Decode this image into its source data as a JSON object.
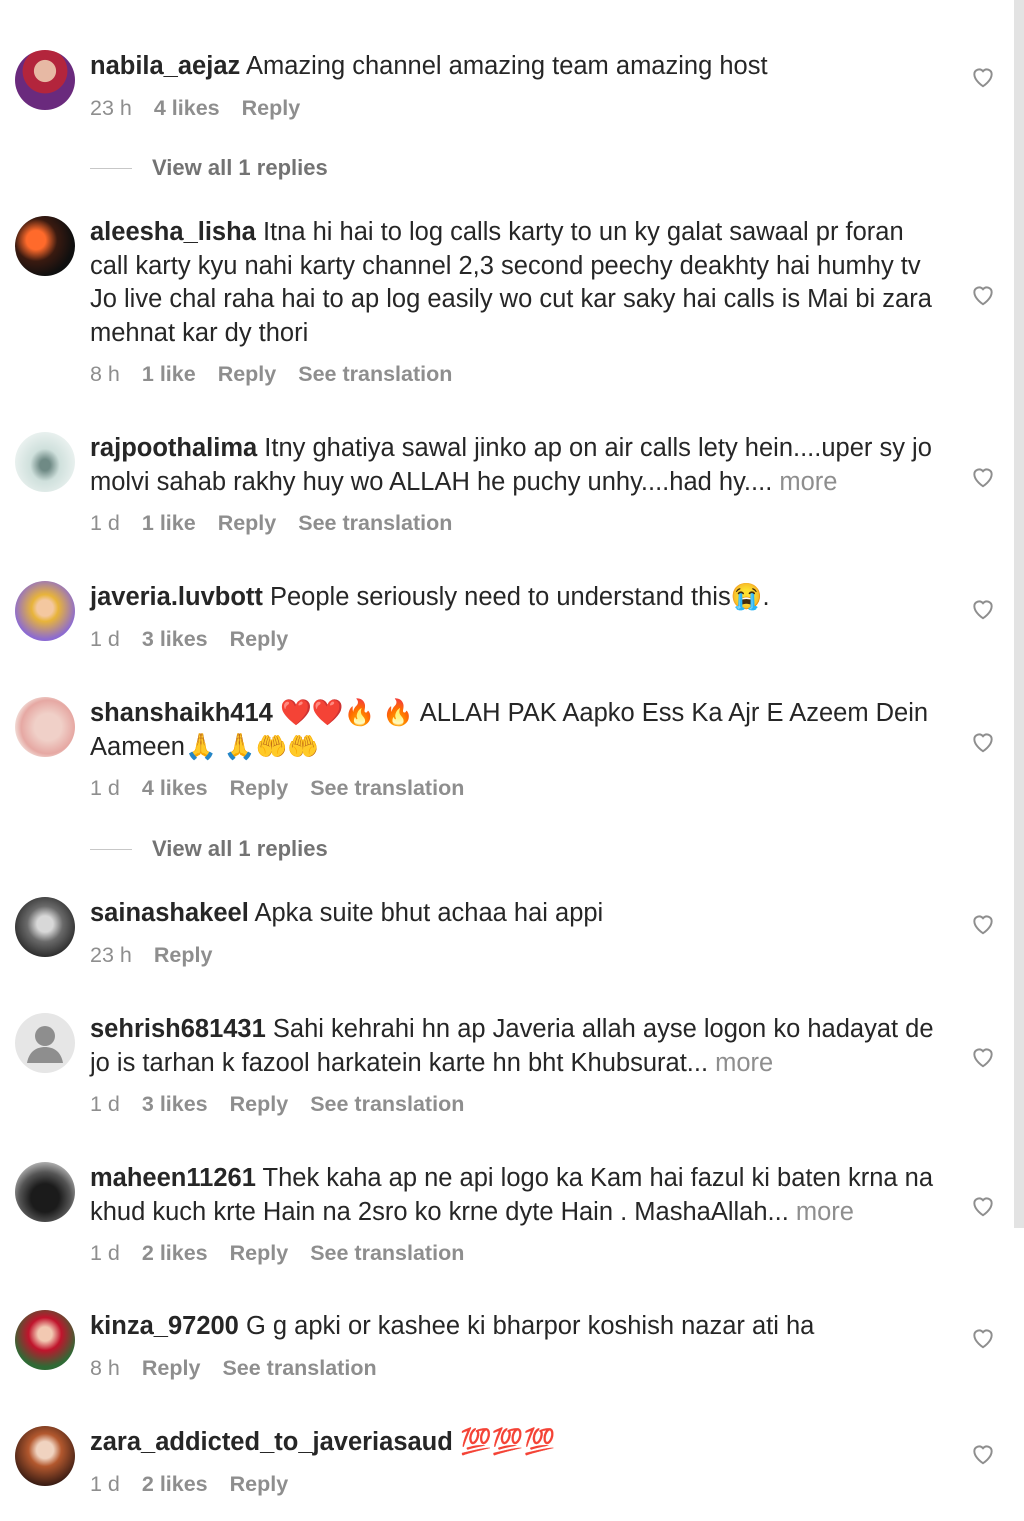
{
  "comments": [
    {
      "username": "nabila_aejaz",
      "text": "Amazing channel amazing team amazing host",
      "more": "",
      "time": "23 h",
      "likes": "4 likes",
      "reply": "Reply",
      "translate": "",
      "emojis": ""
    },
    {
      "username": "aleesha_lisha",
      "text": "Itna hi hai to log calls karty to un ky galat sawaal pr foran call karty kyu nahi karty channel 2,3 second peechy deakhty hai humhy tv Jo live chal raha hai to ap log easily wo cut kar saky hai calls is Mai bi zara mehnat kar dy thori",
      "more": "",
      "time": "8 h",
      "likes": "1 like",
      "reply": "Reply",
      "translate": "See translation",
      "emojis": ""
    },
    {
      "username": "rajpoothalima",
      "text": "Itny ghatiya sawal jinko ap on air calls lety hein....uper sy jo molvi sahab rakhy huy wo ALLAH he puchy unhy....had hy....",
      "more": "more",
      "time": "1 d",
      "likes": "1 like",
      "reply": "Reply",
      "translate": "See translation",
      "emojis": ""
    },
    {
      "username": "javeria.luvbott",
      "text": "People seriously need to understand this😭.",
      "more": "",
      "time": "1 d",
      "likes": "3 likes",
      "reply": "Reply",
      "translate": "",
      "emojis": ""
    },
    {
      "username": "shanshaikh414",
      "text": "❤️❤️🔥 🔥 ALLAH PAK Aapko Ess Ka Ajr E Azeem Dein Aameen🙏 🙏🤲🤲",
      "more": "",
      "time": "1 d",
      "likes": "4 likes",
      "reply": "Reply",
      "translate": "See translation",
      "emojis": ""
    },
    {
      "username": "sainashakeel",
      "text": "Apka suite bhut achaa hai appi",
      "more": "",
      "time": "23 h",
      "likes": "",
      "reply": "Reply",
      "translate": "",
      "emojis": ""
    },
    {
      "username": "sehrish681431",
      "text": "Sahi kehrahi hn ap Javeria allah ayse logon ko hadayat de jo is tarhan k fazool harkatein karte hn bht Khubsurat...",
      "more": "more",
      "time": "1 d",
      "likes": "3 likes",
      "reply": "Reply",
      "translate": "See translation",
      "emojis": ""
    },
    {
      "username": "maheen11261",
      "text": "Thek kaha ap ne api logo ka Kam hai fazul ki baten krna na khud kuch krte Hain na 2sro ko krne dyte Hain . MashaAllah...",
      "more": "more",
      "time": "1 d",
      "likes": "2 likes",
      "reply": "Reply",
      "translate": "See translation",
      "emojis": ""
    },
    {
      "username": "kinza_97200",
      "text": "G g apki or kashee ki bharpor koshish nazar ati ha",
      "more": "",
      "time": "8 h",
      "likes": "",
      "reply": "Reply",
      "translate": "See translation",
      "emojis": ""
    },
    {
      "username": "zara_addicted_to_javeriasaud",
      "text": "💯💯💯",
      "more": "",
      "time": "1 d",
      "likes": "2 likes",
      "reply": "Reply",
      "translate": "",
      "emojis": ""
    }
  ],
  "view_replies": [
    "View all 1 replies",
    "View all 1 replies"
  ],
  "colors": {
    "text": "#262626",
    "muted": "#8e8e8e",
    "background": "#ffffff"
  },
  "icons": {
    "like": "heart-outline-icon"
  }
}
